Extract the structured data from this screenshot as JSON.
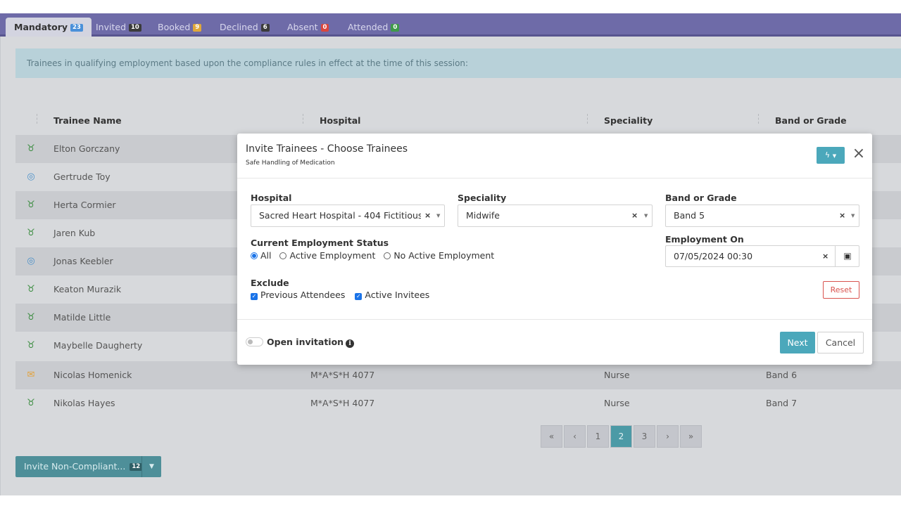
{
  "tabs": [
    {
      "label": "Mandatory",
      "count": "23",
      "badge_color": "#4a90d9"
    },
    {
      "label": "Invited",
      "count": "10",
      "badge_color": "#3b3b3b"
    },
    {
      "label": "Booked",
      "count": "9",
      "badge_color": "#e0a83a"
    },
    {
      "label": "Declined",
      "count": "6",
      "badge_color": "#3b3b3b"
    },
    {
      "label": "Absent",
      "count": "0",
      "badge_color": "#d9463e"
    },
    {
      "label": "Attended",
      "count": "0",
      "badge_color": "#3f9a4a"
    }
  ],
  "notice": "Trainees in qualifying employment based upon the compliance rules in effect at the time of this session:",
  "table": {
    "headers": [
      "Trainee Name",
      "Hospital",
      "Speciality",
      "Band or Grade"
    ],
    "rows": [
      {
        "icon": "taurus-icon",
        "name": "Elton Gorczany",
        "hospital": "",
        "speciality": "",
        "band": ""
      },
      {
        "icon": "target-icon",
        "name": "Gertrude Toy",
        "hospital": "",
        "speciality": "",
        "band": ""
      },
      {
        "icon": "taurus-icon",
        "name": "Herta Cormier",
        "hospital": "",
        "speciality": "",
        "band": ""
      },
      {
        "icon": "taurus-icon",
        "name": "Jaren Kub",
        "hospital": "",
        "speciality": "",
        "band": ""
      },
      {
        "icon": "target-icon",
        "name": "Jonas Keebler",
        "hospital": "",
        "speciality": "",
        "band": ""
      },
      {
        "icon": "taurus-icon",
        "name": "Keaton Murazik",
        "hospital": "",
        "speciality": "",
        "band": ""
      },
      {
        "icon": "taurus-icon",
        "name": "Matilde Little",
        "hospital": "",
        "speciality": "",
        "band": ""
      },
      {
        "icon": "taurus-icon",
        "name": "Maybelle Daugherty",
        "hospital": "",
        "speciality": "",
        "band": ""
      },
      {
        "icon": "envelope-icon",
        "name": "Nicolas Homenick",
        "hospital": "M*A*S*H 4077",
        "speciality": "Nurse",
        "band": "Band 6"
      },
      {
        "icon": "taurus-icon",
        "name": "Nikolas Hayes",
        "hospital": "M*A*S*H 4077",
        "speciality": "Nurse",
        "band": "Band 7"
      }
    ]
  },
  "pagination": {
    "first": "«",
    "prev": "‹",
    "pages": [
      "1",
      "2",
      "3"
    ],
    "current": "2",
    "next": "›",
    "last": "»"
  },
  "invite_button": {
    "label": "Invite Non-Compliant...",
    "count": "12"
  },
  "modal": {
    "title": "Invite Trainees - Choose Trainees",
    "subtitle": "Safe Handling of Medication",
    "hospital_label": "Hospital",
    "hospital_value": "Sacred Heart Hospital - 404 Fictitious ...",
    "speciality_label": "Speciality",
    "speciality_value": "Midwife",
    "band_label": "Band or Grade",
    "band_value": "Band 5",
    "status_label": "Current Employment Status",
    "status_options": [
      "All",
      "Active Employment",
      "No Active Employment"
    ],
    "status_selected": "All",
    "employment_on_label": "Employment On",
    "employment_on_value": "07/05/2024 00:30",
    "exclude_label": "Exclude",
    "exclude_options": [
      "Previous Attendees",
      "Active Invitees"
    ],
    "reset_label": "Reset",
    "open_invitation_label": "Open invitation",
    "next_label": "Next",
    "cancel_label": "Cancel"
  },
  "colors": {
    "accent": "#4ba8bb",
    "tab_bar": "#6e6ba8",
    "icon_green": "#3a8c3f",
    "icon_blue": "#4a90c9",
    "icon_orange": "#e3a23a",
    "danger": "#d9534f"
  }
}
